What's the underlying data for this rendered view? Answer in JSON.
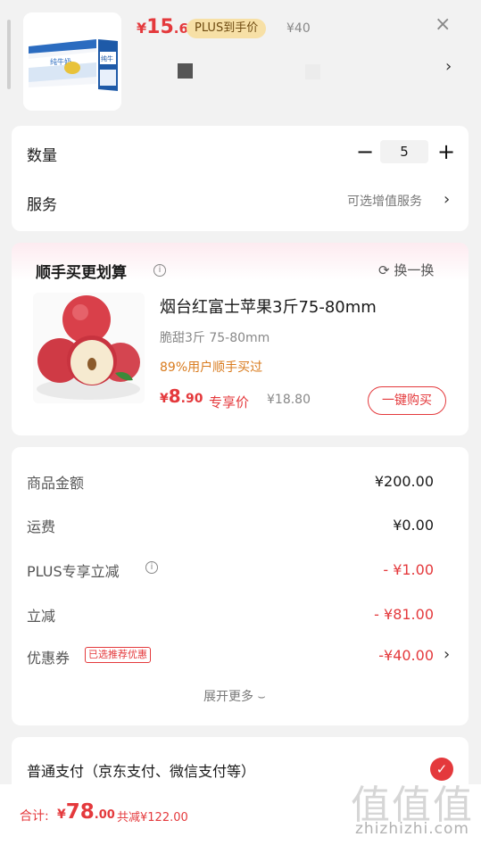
{
  "product": {
    "price_symbol": "¥",
    "price_int": "15",
    "price_dec": ".6",
    "plus_badge": "PLUS到手价",
    "original_price": "¥40",
    "close_glyph": "×",
    "chevron": "›"
  },
  "quantity": {
    "label": "数量",
    "value": "5",
    "minus": "−",
    "plus": "+"
  },
  "service": {
    "label": "服务",
    "option_text": "可选增值服务",
    "chevron": "›"
  },
  "upsell": {
    "title": "顺手买更划算",
    "info_glyph": "i",
    "swap_label": "换一换",
    "swap_glyph": "⟳",
    "item": {
      "name": "烟台红富士苹果3斤75-80mm",
      "spec": "脆甜3斤 75-80mm",
      "popularity": "89%用户顺手买过",
      "price_symbol": "¥",
      "price_int": "8",
      "price_dec": ".90",
      "exclusive_label": "专享价",
      "original_price": "¥18.80",
      "buy_label": "一键购买"
    }
  },
  "summary": {
    "rows": [
      {
        "label": "商品金额",
        "value": "¥200.00"
      },
      {
        "label": "运费",
        "value": "¥0.00"
      },
      {
        "label": "PLUS专享立减",
        "value": "- ¥1.00"
      },
      {
        "label": "立减",
        "value": "- ¥81.00"
      },
      {
        "label": "优惠券",
        "value": "-¥40.00"
      }
    ],
    "coupon_tag": "已选推荐优惠",
    "info_glyph": "i",
    "chevron": "›",
    "expand_label": "展开更多 ⌣"
  },
  "payment": {
    "label": "普通支付（京东支付、微信支付等）",
    "check_glyph": "✓"
  },
  "footer": {
    "total_label": "合计:",
    "total_symbol": "¥",
    "total_int": "78",
    "total_dec": ".00",
    "saved": "共减¥122.00"
  },
  "watermark": {
    "glyphs": "值值值",
    "url": "zhizhizhi.com"
  },
  "colors": {
    "accent_red": "#e4393c",
    "plus_gold": "#f7e0a6",
    "popularity_orange": "#d97b1e"
  }
}
